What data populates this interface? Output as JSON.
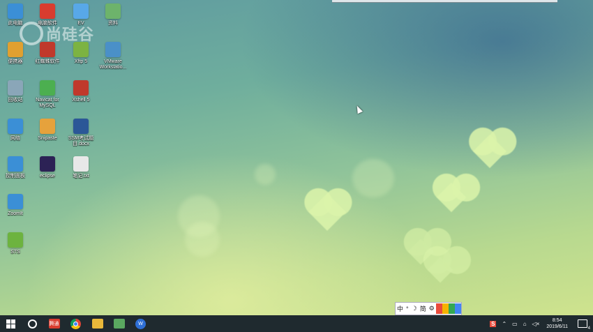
{
  "watermark": {
    "text": "尚硅谷"
  },
  "desktop_icons": [
    {
      "label": "此电脑",
      "icon": "computer-icon",
      "color": "#3b8fd6"
    },
    {
      "label": "电脑软件",
      "icon": "folder-app-icon",
      "color": "#d93c2f"
    },
    {
      "label": "EV",
      "icon": "ev-recorder-icon",
      "color": "#58a8e8"
    },
    {
      "label": "资料",
      "icon": "document-icon",
      "color": "#6db36b"
    },
    {
      "label": "便携器",
      "icon": "portable-app-icon",
      "color": "#e0a030"
    },
    {
      "label": "红蜘蛛软件",
      "icon": "red-spider-icon",
      "color": "#c0392b"
    },
    {
      "label": "Xftp 5",
      "icon": "xftp-icon",
      "color": "#7cb342"
    },
    {
      "label": "VMware Workstatio...",
      "icon": "vmware-icon",
      "color": "#4a90c8"
    },
    {
      "label": "回收站",
      "icon": "recycle-bin-icon",
      "color": "#8aa6b8"
    },
    {
      "label": "Navicat for MySQL",
      "icon": "navicat-icon",
      "color": "#4caf50"
    },
    {
      "label": "Xshell 5",
      "icon": "xshell-icon",
      "color": "#c0392b"
    },
    {
      "label": "网络",
      "icon": "network-icon",
      "color": "#3b8fd6"
    },
    {
      "label": "Snipaste",
      "icon": "snipaste-icon",
      "color": "#e6a23c"
    },
    {
      "label": "SSM考试题目.docx",
      "icon": "word-doc-icon",
      "color": "#2b5797"
    },
    {
      "label": "控制面板",
      "icon": "control-panel-icon",
      "color": "#3b8fd6"
    },
    {
      "label": "eclipse",
      "icon": "eclipse-icon",
      "color": "#2c2255"
    },
    {
      "label": "笔记.txt",
      "icon": "text-file-icon",
      "color": "#e8e8e8"
    },
    {
      "label": "ZoomIt",
      "icon": "zoomit-icon",
      "color": "#3b8fd6"
    },
    {
      "label": "STS",
      "icon": "spring-sts-icon",
      "color": "#6db33f"
    }
  ],
  "ime_toolbar": {
    "items": [
      "中",
      "°",
      "☽",
      "简",
      "⚙"
    ]
  },
  "taskbar": {
    "apps": [
      {
        "name": "start-button",
        "icon": "windows-start-icon"
      },
      {
        "name": "search-button",
        "icon": "search-icon"
      },
      {
        "name": "taskbar-app-1",
        "icon": "app-red-icon",
        "text": "腾通",
        "color": "#d93c2f"
      },
      {
        "name": "taskbar-chrome",
        "icon": "chrome-icon"
      },
      {
        "name": "taskbar-explorer",
        "icon": "folder-icon",
        "color": "#e8b83a"
      },
      {
        "name": "taskbar-app-green",
        "icon": "app-green-icon",
        "color": "#5aa860"
      },
      {
        "name": "taskbar-wps",
        "icon": "wps-icon",
        "text": "W",
        "color": "#2e6fd6"
      }
    ],
    "tray": {
      "ime_icon": "S",
      "clock_time": "8:54",
      "clock_date": "2019/6/11"
    }
  }
}
